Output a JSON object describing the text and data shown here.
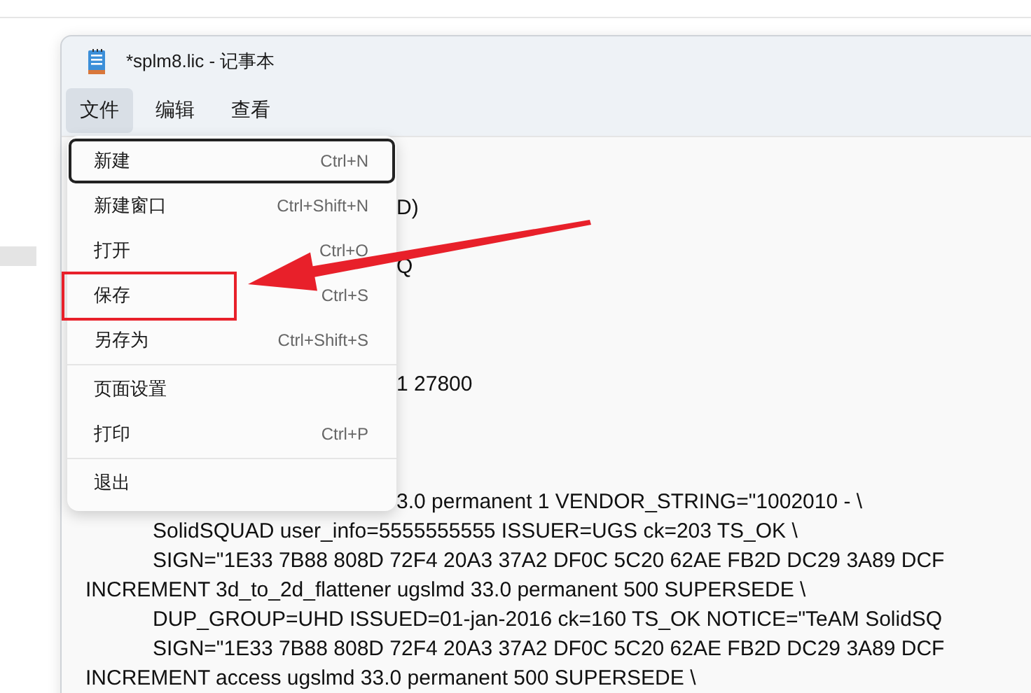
{
  "window": {
    "title": "*splm8.lic - 记事本"
  },
  "menu_bar": [
    {
      "label": "文件",
      "selected": true
    },
    {
      "label": "编辑",
      "selected": false
    },
    {
      "label": "查看",
      "selected": false
    }
  ],
  "file_menu": [
    {
      "kind": "item",
      "label": "新建",
      "shortcut": "Ctrl+N",
      "focused": true,
      "highlighted": false
    },
    {
      "kind": "item",
      "label": "新建窗口",
      "shortcut": "Ctrl+Shift+N",
      "focused": false,
      "highlighted": false
    },
    {
      "kind": "item",
      "label": "打开",
      "shortcut": "Ctrl+O",
      "focused": false,
      "highlighted": false
    },
    {
      "kind": "item",
      "label": "保存",
      "shortcut": "Ctrl+S",
      "focused": false,
      "highlighted": true
    },
    {
      "kind": "item",
      "label": "另存为",
      "shortcut": "Ctrl+Shift+S",
      "focused": false,
      "highlighted": false
    },
    {
      "kind": "separator"
    },
    {
      "kind": "item",
      "label": "页面设置",
      "focused": false,
      "highlighted": false
    },
    {
      "kind": "item",
      "label": "打印",
      "shortcut": "Ctrl+P",
      "focused": false,
      "highlighted": false
    },
    {
      "kind": "separator"
    },
    {
      "kind": "item",
      "label": "退出",
      "focused": false,
      "highlighted": false
    }
  ],
  "editor_lines": [
    {
      "kind": "blank"
    },
    {
      "kind": "after_menu",
      "text": "D)"
    },
    {
      "kind": "blank"
    },
    {
      "kind": "after_menu",
      "text": "Q"
    },
    {
      "kind": "blank"
    },
    {
      "kind": "blank"
    },
    {
      "kind": "blank"
    },
    {
      "kind": "after_menu",
      "text": "1 27800"
    },
    {
      "kind": "blank"
    },
    {
      "kind": "blank"
    },
    {
      "kind": "blank"
    },
    {
      "kind": "after_menu",
      "text": "3.0 permanent 1 VENDOR_STRING=\"1002010 - \\"
    },
    {
      "kind": "indent",
      "text": "SolidSQUAD    user_info=5555555555 ISSUER=UGS ck=203 TS_OK \\"
    },
    {
      "kind": "indent",
      "text": "SIGN=\"1E33 7B88 808D 72F4 20A3 37A2 DF0C 5C20 62AE FB2D DC29 3A89 DCF"
    },
    {
      "kind": "flush",
      "text": "INCREMENT 3d_to_2d_flattener ugslmd 33.0 permanent 500 SUPERSEDE \\"
    },
    {
      "kind": "indent",
      "text": "DUP_GROUP=UHD ISSUED=01-jan-2016 ck=160 TS_OK NOTICE=\"TeAM SolidSQ"
    },
    {
      "kind": "indent",
      "text": "SIGN=\"1E33 7B88 808D 72F4 20A3 37A2 DF0C 5C20 62AE FB2D DC29 3A89 DCF"
    },
    {
      "kind": "flush",
      "text": "INCREMENT access ugslmd 33.0 permanent 500 SUPERSEDE \\"
    }
  ]
}
